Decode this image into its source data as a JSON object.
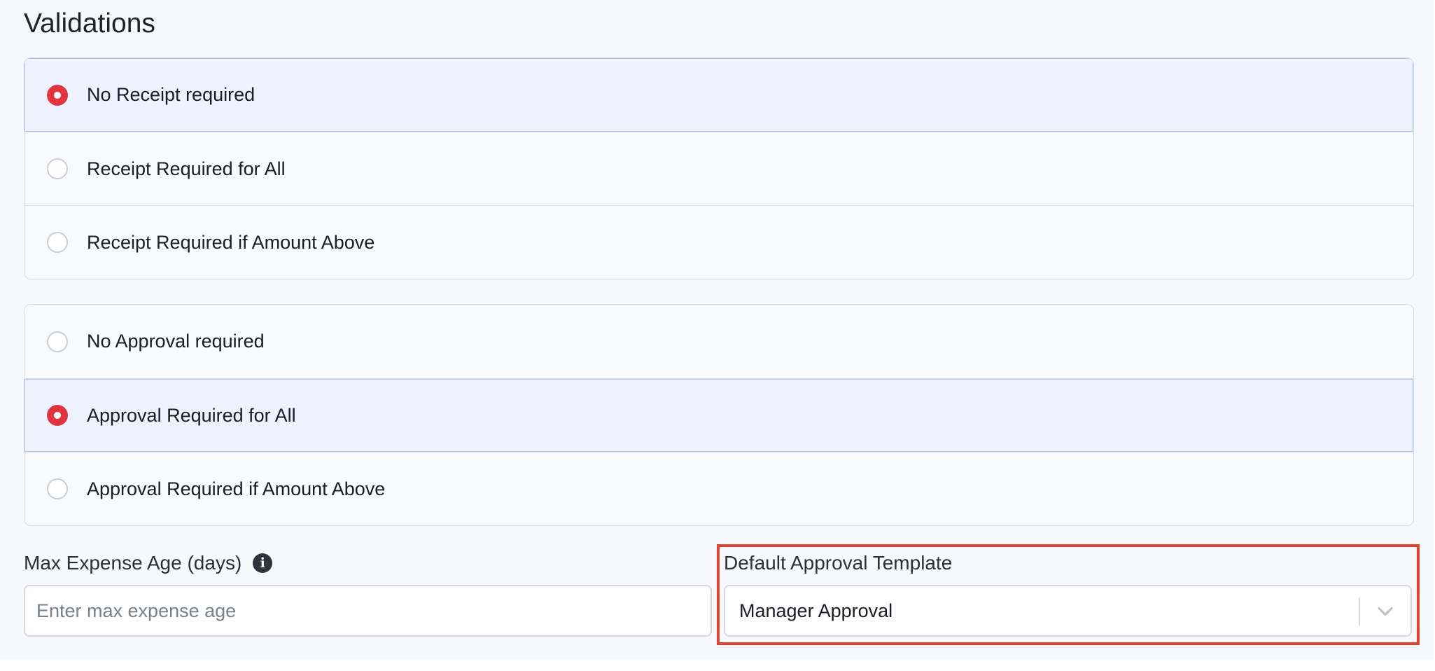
{
  "section": {
    "title": "Validations"
  },
  "receipt_options": [
    {
      "label": "No Receipt required",
      "selected": true
    },
    {
      "label": "Receipt Required for All",
      "selected": false
    },
    {
      "label": "Receipt Required if Amount Above",
      "selected": false
    }
  ],
  "approval_options": [
    {
      "label": "No Approval required",
      "selected": false
    },
    {
      "label": "Approval Required for All",
      "selected": true
    },
    {
      "label": "Approval Required if Amount Above",
      "selected": false
    }
  ],
  "max_expense_age": {
    "label": "Max Expense Age (days)",
    "placeholder": "Enter max expense age",
    "value": "",
    "info_icon": "info-icon"
  },
  "default_approval_template": {
    "label": "Default Approval Template",
    "selected_value": "Manager Approval",
    "dropdown_icon": "chevron-down-icon"
  },
  "colors": {
    "selected_radio": "#e0353f",
    "selected_row_bg": "#eef1fe",
    "highlight_border": "#e0442e"
  }
}
